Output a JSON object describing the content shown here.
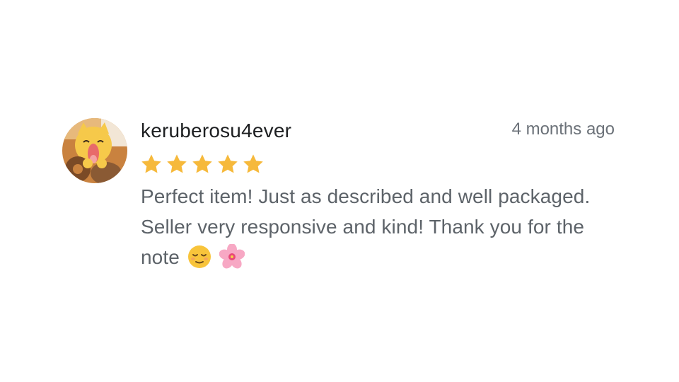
{
  "review": {
    "username": "keruberosu4ever",
    "timestamp": "4 months ago",
    "rating": 5,
    "rating_max": 5,
    "star_color": "#F6B93B",
    "text": "Perfect item! Just as described and well packaged. Seller very responsive and kind! Thank you for the note",
    "emojis": [
      "relieved-face-emoji",
      "cherry-blossom-emoji"
    ],
    "avatar": "cartoon-character-avatar"
  }
}
